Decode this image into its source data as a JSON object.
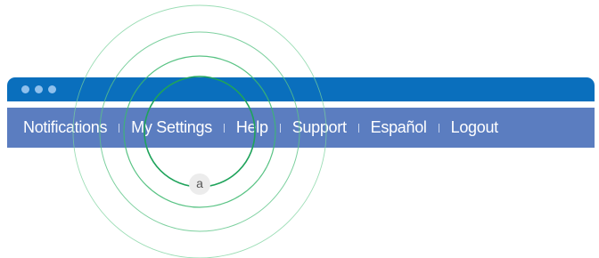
{
  "window": {
    "title_dots": [
      "dot",
      "dot",
      "dot"
    ]
  },
  "navbar": {
    "items": [
      {
        "label": "Notifications"
      },
      {
        "label": "My Settings"
      },
      {
        "label": "Help"
      },
      {
        "label": "Support"
      },
      {
        "label": "Español"
      },
      {
        "label": "Logout"
      }
    ]
  },
  "annotation": {
    "marker_label": "a"
  },
  "colors": {
    "titlebar": "#0a6fbd",
    "navbar": "#5b7dc0",
    "ring": "#2fb36a"
  }
}
